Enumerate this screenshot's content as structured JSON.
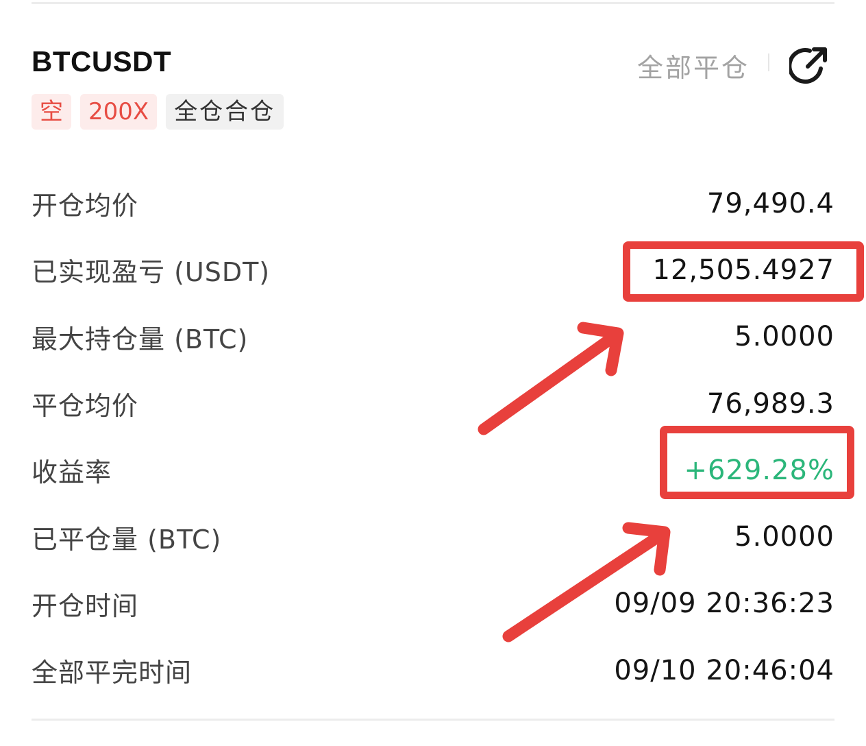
{
  "position": {
    "symbol": "BTCUSDT",
    "close_all_label": "全部平仓",
    "share_icon": "share-external-icon",
    "tags": {
      "side": "空",
      "leverage": "200X",
      "margin_mode": "全仓合仓"
    }
  },
  "details": [
    {
      "label": "开仓均价",
      "value": "79,490.4"
    },
    {
      "label": "已实现盈亏 (USDT)",
      "value": "12,505.4927"
    },
    {
      "label": "最大持仓量 (BTC)",
      "value": "5.0000"
    },
    {
      "label": "平仓均价",
      "value": "76,989.3"
    },
    {
      "label": "收益率",
      "value": "+629.28%"
    },
    {
      "label": "已平仓量 (BTC)",
      "value": "5.0000"
    },
    {
      "label": "开仓时间",
      "value": "09/09 20:36:23"
    },
    {
      "label": "全部平完时间",
      "value": "09/10 20:46:04"
    }
  ],
  "colors": {
    "positive": "#2bb67a",
    "short_tag": "#e74c43",
    "annotation": "#e8403c"
  }
}
